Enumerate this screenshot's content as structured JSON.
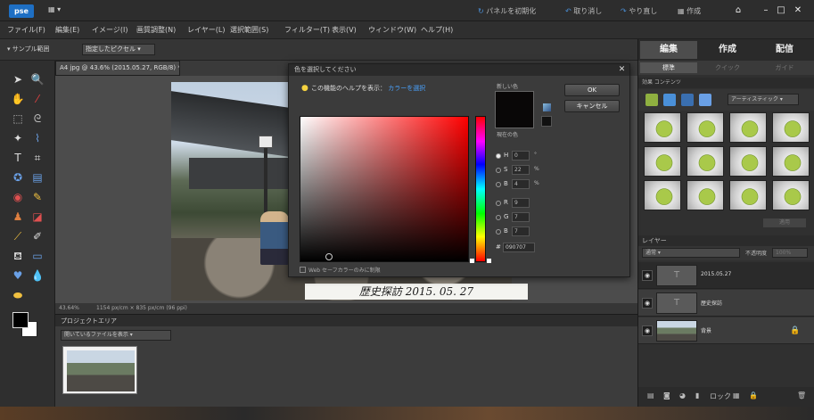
{
  "titlebar": {
    "logo": "pse",
    "menu_icon": "▦ ▾",
    "reset_panels": "パネルを初期化",
    "undo": "取り消し",
    "redo": "やり直し",
    "create_label": "作成",
    "minimize": "–",
    "maximize": "□",
    "close": "✕"
  },
  "menubar": [
    "ファイル(F)",
    "編集(E)",
    "イメージ(I)",
    "画質調整(N)",
    "レイヤー(L)",
    "選択範囲(S)",
    "フィルター(T)",
    "表示(V)",
    "ウィンドウ(W)",
    "ヘルプ(H)"
  ],
  "optbar": {
    "label": "サンプル範囲",
    "select_value": "指定したピクセル"
  },
  "document": {
    "tab": "A4 jpg @ 43.6% (2015.05.27, RGB/8) *  ×",
    "caption": "歴史探訪 2015. 05. 27",
    "zoom": "43.64%",
    "size_info": "1154 px/cm × 835 px/cm (96 ppi)"
  },
  "project": {
    "header": "プロジェクトエリア",
    "select": "開いているファイルを表示"
  },
  "right_panel": {
    "tabs": [
      "編集",
      "作成",
      "配信"
    ],
    "subtabs": [
      "標準",
      "クイック",
      "ガイド"
    ],
    "effects_header": "効果  コンテンツ",
    "effects_select": "アーティスティック",
    "apply": "適用",
    "layers_header": "レイヤー",
    "blend_mode": "通常",
    "opacity_label": "不透明度",
    "opacity_value": "100%",
    "layers": [
      {
        "name": "2015.05.27",
        "thumb": "T"
      },
      {
        "name": "歴史探訪",
        "thumb": "T"
      },
      {
        "name": "背景",
        "thumb": ""
      }
    ],
    "bottom_icons": [
      "▤",
      "◙",
      "◕",
      "▮",
      "ロック",
      "▦",
      "🔒",
      "🗑"
    ]
  },
  "dialog": {
    "title": "色を選択してください",
    "hint": "この機能のヘルプを表示：",
    "hint_link": "カラーを選択",
    "new_label": "新しい色",
    "current_label": "現在の色",
    "ok": "OK",
    "cancel": "キャンセル",
    "fields": [
      {
        "key": "H",
        "value": "0",
        "unit": "°",
        "on": true
      },
      {
        "key": "S",
        "value": "22",
        "unit": "%",
        "on": false
      },
      {
        "key": "B",
        "value": "4",
        "unit": "%",
        "on": false
      },
      {
        "key": "R",
        "value": "9",
        "unit": "",
        "on": false
      },
      {
        "key": "G",
        "value": "7",
        "unit": "",
        "on": false
      },
      {
        "key": "B",
        "value": "7",
        "unit": "",
        "on": false
      }
    ],
    "hex_key": "#",
    "hex": "090707",
    "web_only": "Web セーフカラーのみに制限",
    "color_swatch": "#090707"
  }
}
